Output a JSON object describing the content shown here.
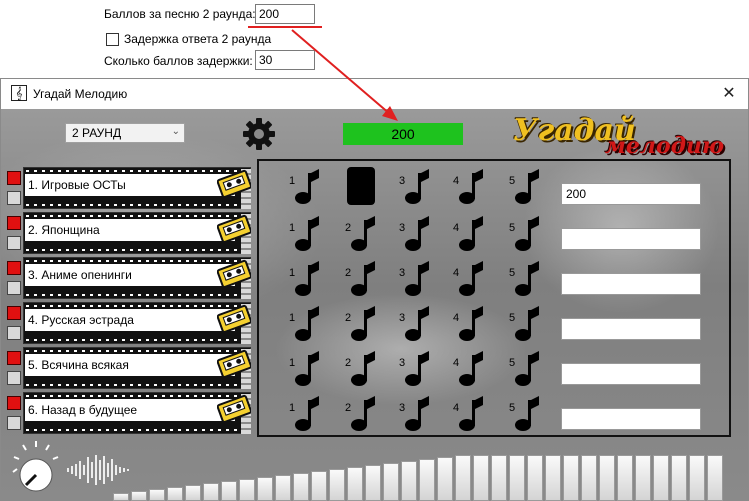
{
  "settings": {
    "points_label": "Баллов за песню 2 раунда:",
    "points_value": "200",
    "delay_checkbox_label": "Задержка ответа 2 раунда",
    "delay_points_label": "Сколько баллов задержки:",
    "delay_points_value": "30"
  },
  "window": {
    "title": "Угадай Мелодию",
    "close_glyph": "✕"
  },
  "game": {
    "round_select": "2 РАУНД",
    "score": "200",
    "logo_line1": "Угадай",
    "logo_line2": "мелодию",
    "categories": [
      {
        "label": "1. Игровые ОСТы"
      },
      {
        "label": "2. Японщина"
      },
      {
        "label": "3. Аниме опенинги"
      },
      {
        "label": "4. Русская эстрада"
      },
      {
        "label": "5. Всячина всякая"
      },
      {
        "label": "6. Назад в будущее"
      }
    ],
    "note_numbers": [
      "1",
      "2",
      "3",
      "4",
      "5"
    ],
    "opened_note": {
      "row": 1,
      "col": 2
    },
    "score_fields": [
      "200",
      "",
      "",
      "",
      "",
      ""
    ]
  },
  "colors": {
    "score_bg": "#1ec21e",
    "led_red": "#e01010",
    "annotation_red": "#e02020",
    "logo_yellow": "#f0c020",
    "logo_red": "#d01818"
  },
  "icons": {
    "gear": "gear-icon",
    "note": "music-note-icon",
    "cassette": "cassette-icon",
    "knob": "volume-knob-icon",
    "wave": "waveform-icon"
  }
}
